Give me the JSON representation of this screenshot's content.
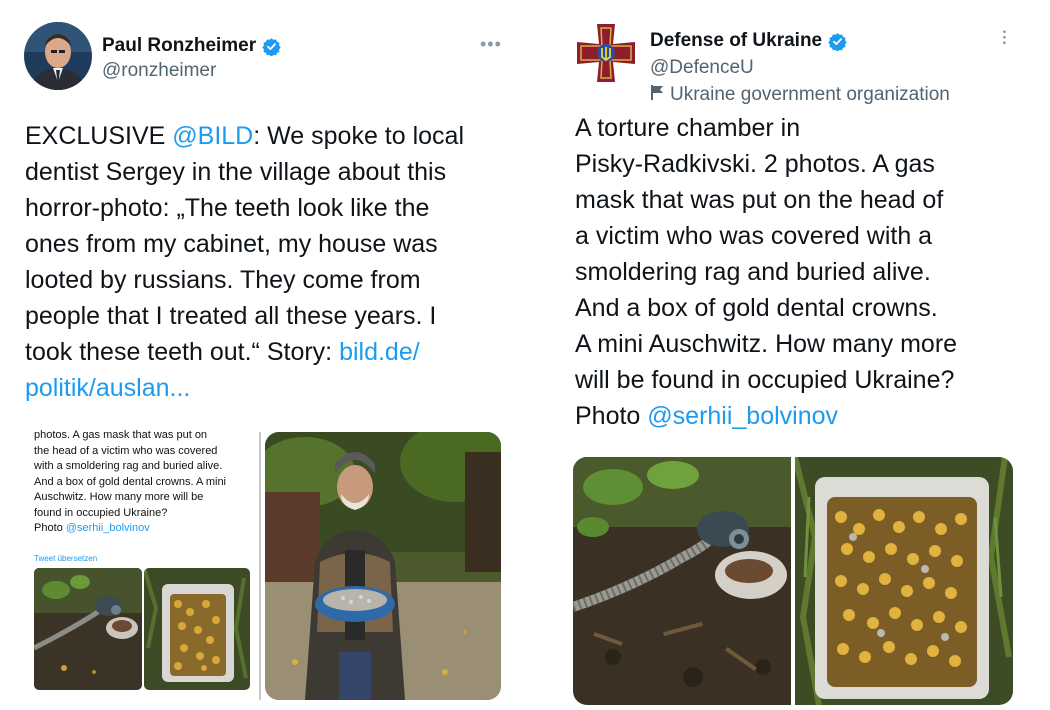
{
  "left_tweet": {
    "author_name": "Paul Ronzheimer",
    "handle": "@ronzheimer",
    "text": {
      "line1_a": "EXCLUSIVE ",
      "line1_mention": "@BILD",
      "line1_b": ": We spoke to local",
      "line2": "dentist Sergey in the village about this",
      "line3": "horror-photo: „The teeth look like the",
      "line4": "ones from my cabinet, my house was",
      "line5": "looted by russians. They come from",
      "line6": "people that I treated all these years. I",
      "line7_a": "took these teeth out.“ Story: ",
      "line7_link": "bild.de/",
      "line8_link": "politik/auslan..."
    },
    "embedded_screenshot": {
      "line1": "photos. A gas mask that was put on",
      "line2": "the head of a victim who was covered",
      "line3": "with a smoldering rag and buried alive.",
      "line4": "And a box of gold dental crowns. A mini",
      "line5": "Auschwitz. How many more will be",
      "line6": "found in occupied Ukraine?",
      "line7_a": "Photo ",
      "line7_mention": "@serhii_bolvinov",
      "translate": "Tweet übersetzen"
    }
  },
  "right_tweet": {
    "author_name": "Defense of Ukraine",
    "handle": "@DefenceU",
    "label": "Ukraine government organization",
    "text": {
      "line1": "A torture chamber in",
      "line2": "Pisky-Radkivski. 2 photos. A gas",
      "line3": "mask that was put on the head of",
      "line4": "a victim who was covered with a",
      "line5": "smoldering rag and buried alive.",
      "line6": "And a box of gold dental crowns.",
      "line7": "A mini Auschwitz. How many more",
      "line8": "will be found in occupied Ukraine?",
      "line9_a": "Photo ",
      "line9_mention": "@serhii_bolvinov"
    }
  },
  "colors": {
    "link": "#1d9bf0",
    "text": "#0f1419",
    "secondary": "#536471",
    "verified": "#1d9bf0"
  },
  "icons": [
    "verified-badge-icon",
    "more-options-icon",
    "flag-icon",
    "ukraine-defense-emblem"
  ]
}
